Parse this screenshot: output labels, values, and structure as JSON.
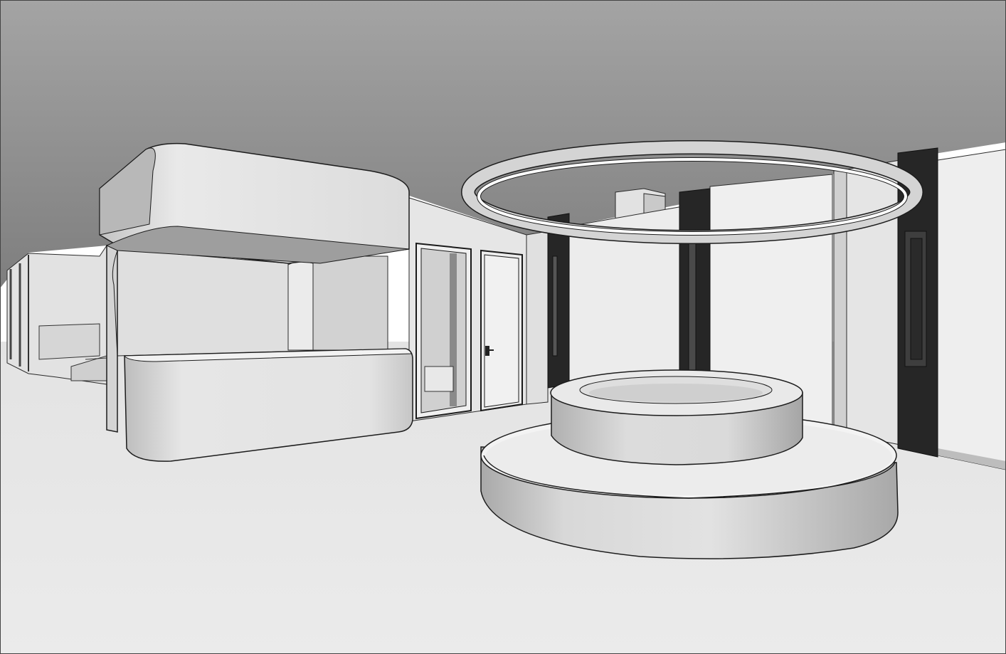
{
  "scene": {
    "style": "grayscale architectural interior rendering",
    "elements": [
      "ceiling",
      "floor",
      "reception-desk",
      "curved-canopy",
      "glass-door",
      "door",
      "ring-pendant-light",
      "column",
      "round-platform-base",
      "round-platform-top",
      "window-wall",
      "black-mullion"
    ]
  },
  "colors": {
    "ceiling_light": "#a9a9a9",
    "ceiling_dark": "#7d7d7d",
    "floor": "#e7e7e7",
    "wall": "#e4e4e4",
    "wall_shade": "#d3d3d3",
    "window": "#ececec",
    "mullion": "#242424",
    "ring_light": "#ffffff",
    "outline": "#1c1c1c"
  }
}
